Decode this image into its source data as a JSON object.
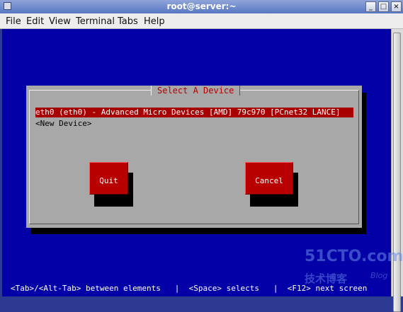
{
  "window": {
    "title": "root@server:~",
    "controls": {
      "minimize": "_",
      "maximize": "□",
      "close": "×"
    }
  },
  "menu": {
    "items": [
      "File",
      "Edit",
      "View",
      "Terminal",
      "Tabs",
      "Help"
    ]
  },
  "dialog": {
    "title": "Select A Device",
    "devices": [
      "eth0 (eth0) - Advanced Micro Devices [AMD] 79c970 [PCnet32 LANCE]",
      "<New Device>"
    ],
    "selected_index": 0,
    "buttons": {
      "quit": "Quit",
      "cancel": "Cancel"
    }
  },
  "watermark": {
    "logo": "51CTO.com",
    "subtitle": "技术博客",
    "blog": "Blog"
  },
  "status_line": "<Tab>/<Alt-Tab> between elements   |  <Space> selects   |  <F12> next screen",
  "colors": {
    "terminal_bg": "#0300a8",
    "dialog_bg": "#a8a8a8",
    "selection_bg": "#a80000",
    "button_bg": "#b90000",
    "dialog_title_color": "#b40000"
  }
}
